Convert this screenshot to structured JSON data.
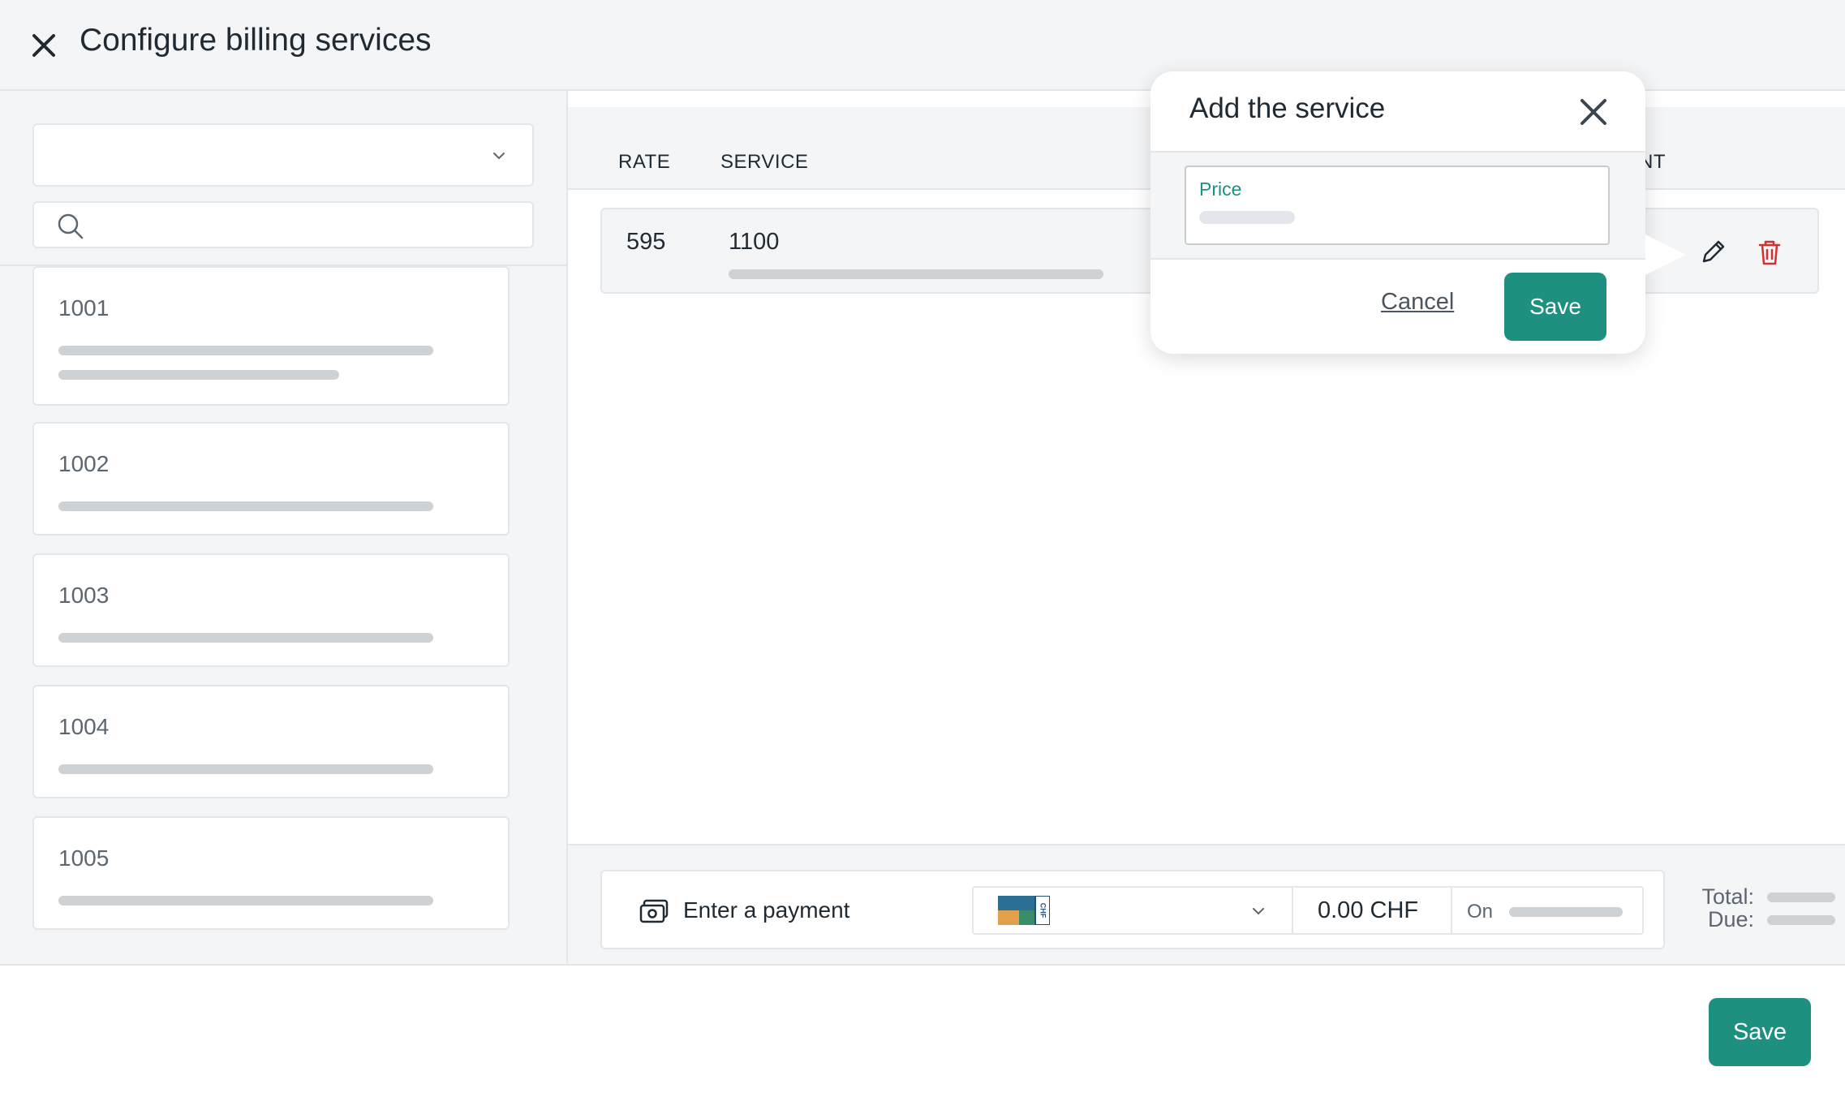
{
  "header": {
    "title": "Configure billing services"
  },
  "sidebar": {
    "select_value": "",
    "search_placeholder": "",
    "cards": [
      {
        "code": "1001"
      },
      {
        "code": "1002"
      },
      {
        "code": "1003"
      },
      {
        "code": "1004"
      },
      {
        "code": "1005"
      }
    ]
  },
  "table": {
    "columns": {
      "rate": "RATE",
      "service": "SERVICE",
      "amount_partial": "NT"
    },
    "rows": [
      {
        "rate": "595",
        "service": "1100"
      }
    ]
  },
  "payment": {
    "label": "Enter a payment",
    "currency_flag": "CHF",
    "amount": "0.00 CHF",
    "date_prefix": "On",
    "total_label": "Total:",
    "due_label": "Due:"
  },
  "footer": {
    "save_label": "Save"
  },
  "popover": {
    "title": "Add the service",
    "price_label": "Price",
    "cancel_label": "Cancel",
    "save_label": "Save"
  },
  "colors": {
    "accent": "#1e9080",
    "danger": "#d32f2f",
    "skeleton": "#cfd2d5"
  }
}
